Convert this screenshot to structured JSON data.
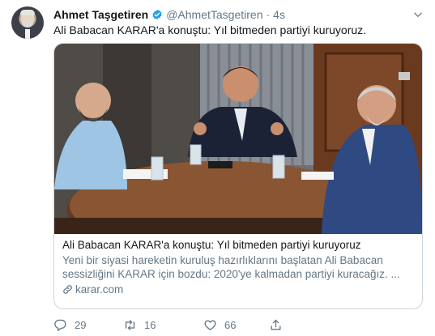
{
  "tweet": {
    "author_name": "Ahmet Taşgetiren",
    "handle": "@AhmetTasgetiren",
    "separator": "·",
    "time": "4s",
    "text": "Ali Babacan KARAR'a konuştu: Yıl bitmeden partiyi kuruyoruz."
  },
  "card": {
    "title": "Ali Babacan KARAR'a konuştu: Yıl bitmeden partiyi kuruyoruz",
    "description_line1": "Yeni bir siyasi hareketin kuruluş hazırlıklarını başlatan Ali Babacan",
    "description_line2": "sessizliğini KARAR için bozdu: 2020'ye kalmadan partiyi kuracağız. ...",
    "domain": "karar.com"
  },
  "actions": {
    "reply_count": "29",
    "retweet_count": "16",
    "like_count": "66"
  },
  "colors": {
    "accent": "#1da1f2",
    "secondary_text": "#657786",
    "border": "#ccd6dd"
  },
  "icons": [
    "verified-icon",
    "chevron-down-icon",
    "reply-icon",
    "retweet-icon",
    "like-icon",
    "share-icon",
    "link-icon"
  ]
}
